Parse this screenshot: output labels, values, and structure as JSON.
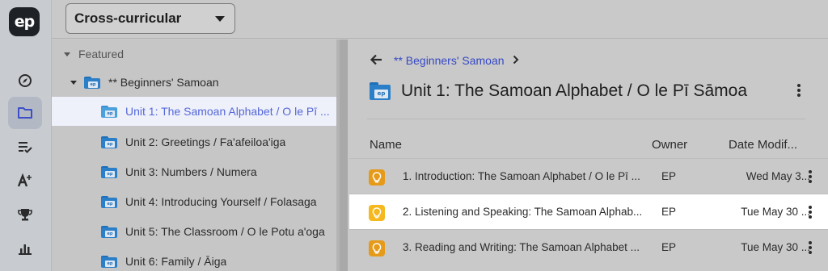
{
  "app": {
    "logo_text": "ep",
    "accent_color": "#5568d8",
    "nav_icons": [
      "compass-icon",
      "folder-icon",
      "playlist-check-icon",
      "grade-a-plus-icon",
      "trophy-icon",
      "bar-chart-icon"
    ],
    "active_nav": "folder-icon"
  },
  "topbar": {
    "subject_select": "Cross-curricular"
  },
  "tree": {
    "section_label": "Featured",
    "course": "** Beginners' Samoan",
    "units": [
      {
        "label": "Unit 1: The Samoan Alphabet / O le Pī Sāmoa",
        "display": "Unit 1: The Samoan Alphabet / O le Pī ...",
        "selected": true
      },
      {
        "label": "Unit 2: Greetings / Fa'afeiloa'iga",
        "display": "Unit 2: Greetings / Fa'afeiloa'iga"
      },
      {
        "label": "Unit 3: Numbers / Numera",
        "display": "Unit 3: Numbers / Numera"
      },
      {
        "label": "Unit 4: Introducing Yourself / Folasaga",
        "display": "Unit 4: Introducing Yourself / Folasaga"
      },
      {
        "label": "Unit 5: The Classroom / O le Potu a'oga",
        "display": "Unit 5: The Classroom / O le Potu a'oga"
      },
      {
        "label": "Unit 6: Family / Āiga",
        "display": "Unit 6: Family / Āiga"
      }
    ]
  },
  "content": {
    "breadcrumb": "** Beginners' Samoan",
    "title": "Unit 1: The Samoan Alphabet / O le Pī Sāmoa",
    "columns": {
      "name": "Name",
      "owner": "Owner",
      "date": "Date Modif..."
    },
    "rows": [
      {
        "name": "1. Introduction: The Samoan Alphabet / O le Pī ...",
        "owner": "EP",
        "date": "Wed May 3..."
      },
      {
        "name": "2. Listening and Speaking: The Samoan Alphab...",
        "owner": "EP",
        "date": "Tue May 30 ..."
      },
      {
        "name": "3. Reading and Writing: The Samoan Alphabet ...",
        "owner": "EP",
        "date": "Tue May 30 ..."
      }
    ]
  }
}
